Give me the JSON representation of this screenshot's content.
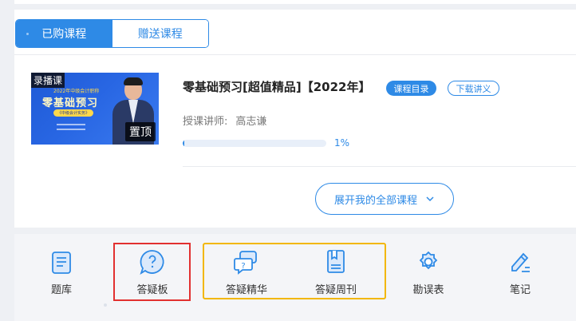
{
  "tabs": [
    {
      "label": "已购课程",
      "active": true
    },
    {
      "label": "赠送课程",
      "active": false
    }
  ],
  "course": {
    "thumbnail": {
      "tag": "录播课",
      "subtitle": "2022年中级会计职称",
      "headline": "零基础预习",
      "pill": "《中级会计实务》",
      "pin_label": "置顶"
    },
    "title": "零基础预习[超值精品]【2022年】",
    "catalog_button": "课程目录",
    "download_button": "下载讲义",
    "teacher_label": "授课讲师:",
    "teacher_name": "高志谦",
    "progress_percent": 1,
    "progress_text": "1%"
  },
  "expand_button": "展开我的全部课程",
  "toolbar": {
    "items": [
      {
        "label": "题库",
        "icon": "question-bank-icon"
      },
      {
        "label": "答疑板",
        "icon": "qa-board-icon"
      },
      {
        "label": "答疑精华",
        "icon": "qa-highlights-icon"
      },
      {
        "label": "答疑周刊",
        "icon": "qa-weekly-icon"
      },
      {
        "label": "勘误表",
        "icon": "errata-gear-icon"
      },
      {
        "label": "笔记",
        "icon": "notes-pen-icon"
      }
    ]
  },
  "colors": {
    "accent": "#2e8ae6",
    "highlight_red": "#e23030",
    "highlight_yellow": "#f2b705"
  }
}
